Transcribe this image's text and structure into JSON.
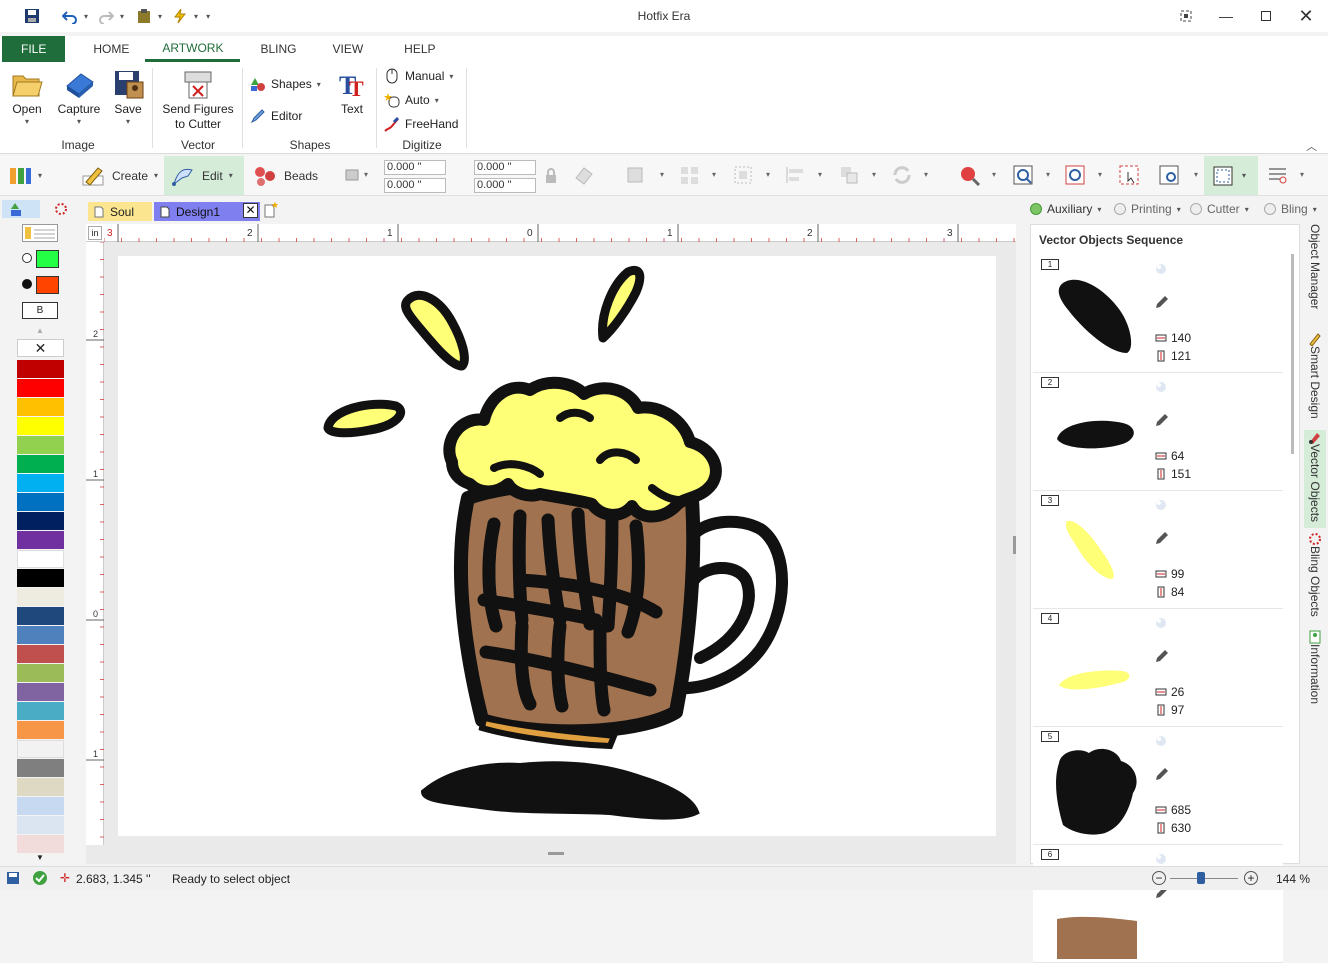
{
  "window": {
    "title": "Hotfix Era"
  },
  "ribbon_tabs": [
    {
      "label": "FILE"
    },
    {
      "label": "HOME"
    },
    {
      "label": "ARTWORK"
    },
    {
      "label": "BLING"
    },
    {
      "label": "VIEW"
    },
    {
      "label": "HELP"
    }
  ],
  "ribbon": {
    "image_group": {
      "label": "Image",
      "open": "Open",
      "capture": "Capture",
      "save": "Save"
    },
    "vector_group": {
      "label": "Vector",
      "send": "Send Figures\nto Cutter"
    },
    "shapes_group": {
      "label": "Shapes",
      "shapes": "Shapes",
      "editor": "Editor",
      "text": "Text"
    },
    "digitize_group": {
      "label": "Digitize",
      "manual": "Manual",
      "auto": "Auto",
      "freehand": "FreeHand"
    }
  },
  "toolbar": {
    "create": "Create",
    "edit": "Edit",
    "beads": "Beads",
    "pos_x": "0.000 \"",
    "pos_y": "0.000 \"",
    "width": "0.000 \"",
    "height": "0.000 \""
  },
  "doc_tabs": [
    {
      "label": "Soul",
      "active": false
    },
    {
      "label": "Design1",
      "active": true
    }
  ],
  "filters": [
    {
      "label": "Auxiliary",
      "active": true
    },
    {
      "label": "Printing",
      "active": false
    },
    {
      "label": "Cutter",
      "active": false
    },
    {
      "label": "Bling",
      "active": false
    }
  ],
  "palette": {
    "stroke_color": "#22ff44",
    "fill_color": "#ff4400",
    "b_label": "B",
    "swatches": [
      "#c00000",
      "#ff0000",
      "#ffc000",
      "#ffff00",
      "#92d050",
      "#00b050",
      "#00b0f0",
      "#0070c0",
      "#002060",
      "#7030a0",
      "#ffffff",
      "#000000",
      "#eeece1",
      "#1f497d",
      "#4f81bd",
      "#c0504d",
      "#9bbb59",
      "#8064a2",
      "#4bacc6",
      "#f79646",
      "#f2f2f2",
      "#7f7f7f",
      "#ddd9c3",
      "#c6d9f0",
      "#dbe5f1",
      "#f2dcdb"
    ]
  },
  "rulers": {
    "unit": "in",
    "h_ticks": [
      "3",
      "2",
      "1",
      "0",
      "1",
      "2",
      "3"
    ],
    "v_ticks": [
      "2",
      "1",
      "0",
      "1"
    ]
  },
  "vector_panel": {
    "title": "Vector Objects Sequence",
    "items": [
      {
        "index": "1",
        "w": "140",
        "h": "121",
        "color": "#111111"
      },
      {
        "index": "2",
        "w": "64",
        "h": "151",
        "color": "#111111"
      },
      {
        "index": "3",
        "w": "99",
        "h": "84",
        "color": "#ffff77"
      },
      {
        "index": "4",
        "w": "26",
        "h": "97",
        "color": "#ffff77"
      },
      {
        "index": "5",
        "w": "685",
        "h": "630",
        "color": "#111111"
      },
      {
        "index": "6",
        "w": "",
        "h": "",
        "color": "#a0724f"
      }
    ]
  },
  "side_tabs": [
    {
      "label": "Object Manager"
    },
    {
      "label": "Smart Design"
    },
    {
      "label": "Vector Objects"
    },
    {
      "label": "Bling Objects"
    },
    {
      "label": "Information"
    }
  ],
  "status": {
    "coords": "2.683, 1.345 ''",
    "message": "Ready to select object",
    "zoom": "144 %",
    "zoom_level": 0.45
  },
  "colors": {
    "accent": "#1f6d3a",
    "highlight": "#d5ecd9",
    "foam": "#ffff77",
    "mug": "#a0724f"
  }
}
